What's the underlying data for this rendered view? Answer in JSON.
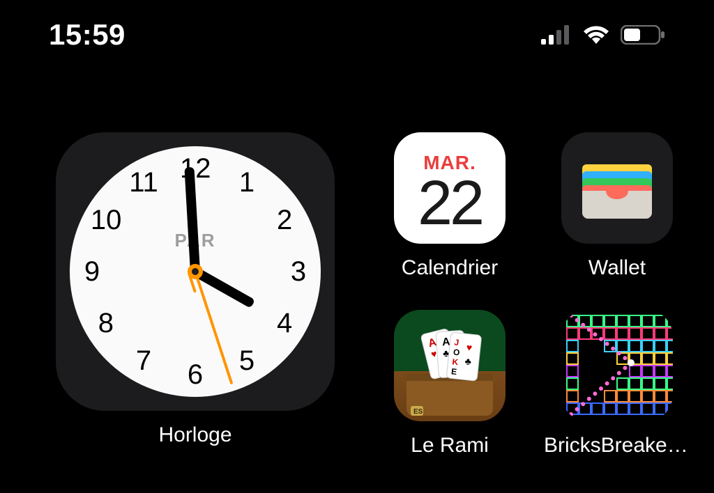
{
  "status": {
    "time": "15:59",
    "signal_bars": 2,
    "wifi": true,
    "battery_pct": 45
  },
  "clock_widget": {
    "label": "Horloge",
    "city_code": "PAR",
    "hours": 15,
    "minutes": 59,
    "seconds": 27,
    "numerals": [
      "12",
      "1",
      "2",
      "3",
      "4",
      "5",
      "6",
      "7",
      "8",
      "9",
      "10",
      "11"
    ]
  },
  "apps": [
    {
      "id": "calendar",
      "label": "Calendrier",
      "day_abbrev": "MAR.",
      "date": "22"
    },
    {
      "id": "wallet",
      "label": "Wallet"
    },
    {
      "id": "rami",
      "label": "Le Rami"
    },
    {
      "id": "bricksbreaker",
      "label": "BricksBreaker..."
    }
  ],
  "colors": {
    "accent_orange": "#ff9500",
    "calendar_red": "#ec3c3c",
    "tile_bg": "#1c1c1e"
  }
}
